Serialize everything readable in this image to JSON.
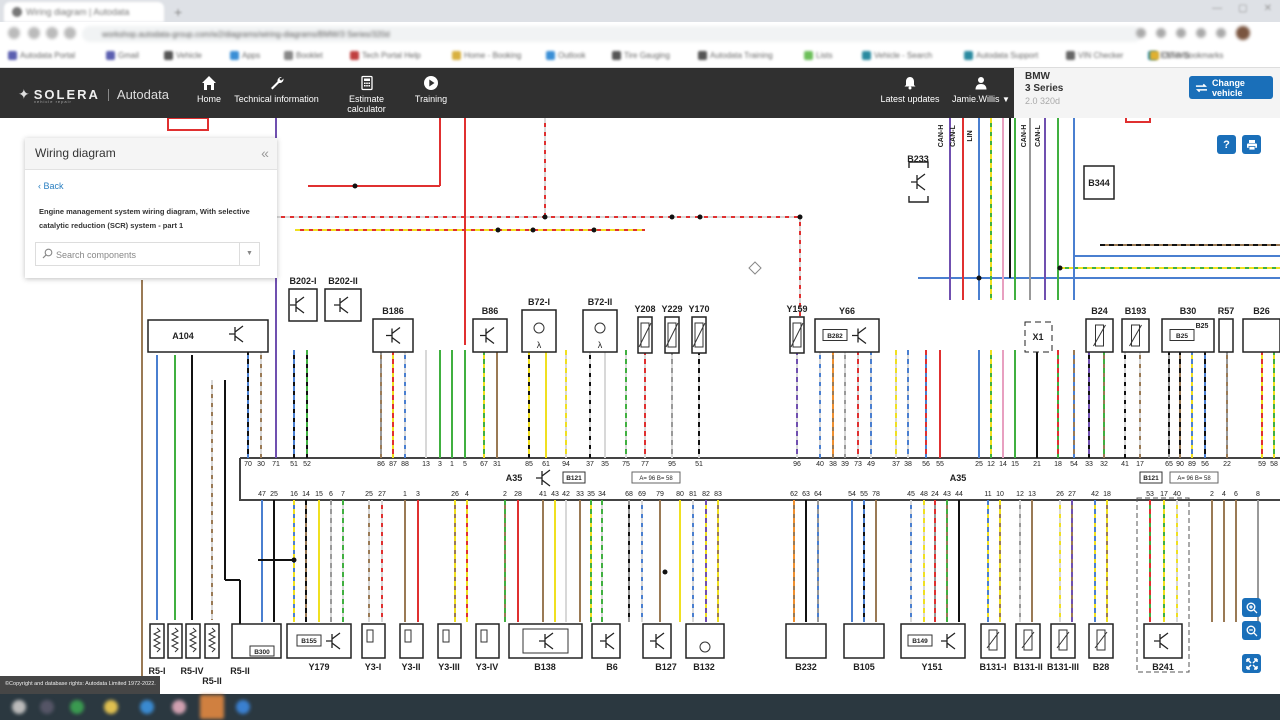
{
  "browser": {
    "tab_title": "Wiring diagram | Autodata",
    "url": "workshop.autodata-group.com/w2/diagrams/wiring-diagrams/BMW/3 Series/320d",
    "bookmarks": [
      {
        "label": "Autodata Portal",
        "color": "#5b5fb0"
      },
      {
        "label": "Gmail",
        "color": "#5b5fb0"
      },
      {
        "label": "Vehicle",
        "color": "#555"
      },
      {
        "label": "Apps",
        "color": "#3a8fd6"
      },
      {
        "label": "Booklet",
        "color": "#888"
      },
      {
        "label": "Tech Portal Help",
        "color": "#c04040"
      },
      {
        "label": "Home - Booking",
        "color": "#d8b040"
      },
      {
        "label": "Outlook",
        "color": "#3a8fd6"
      },
      {
        "label": "Tire Gauging",
        "color": "#555"
      },
      {
        "label": "Autodata Training",
        "color": "#555"
      },
      {
        "label": "Lists",
        "color": "#6cbf5a"
      },
      {
        "label": "Vehicle - Search",
        "color": "#2a8aa0"
      },
      {
        "label": "Autodata Support",
        "color": "#2a8aa0"
      },
      {
        "label": "VIN Checker",
        "color": "#666"
      },
      {
        "label": "ESTIMS",
        "color": "#2a8aa0"
      },
      {
        "label": "Other bookmarks",
        "color": "#e0b030"
      }
    ]
  },
  "app": {
    "brand": "SOLERA",
    "brand_sub": "vehicle repair",
    "product": "Autodata",
    "nav": [
      {
        "label": "Home",
        "icon": "home-icon"
      },
      {
        "label": "Technical information",
        "icon": "wrench-icon"
      },
      {
        "label": "Estimate calculator",
        "icon": "calculator-icon"
      },
      {
        "label": "Training",
        "icon": "play-icon"
      }
    ],
    "latest_updates": "Latest updates",
    "user": "Jamie.Willis"
  },
  "vehicle": {
    "make": "BMW",
    "model": "3 Series",
    "engine": "2.0 320d",
    "change_label": "Change vehicle"
  },
  "side_panel": {
    "title": "Wiring diagram",
    "back": "Back",
    "description": "Engine management system wiring diagram, With selective catalytic reduction (SCR) system - part 1",
    "search_placeholder": "Search components"
  },
  "tools": {
    "help": "?",
    "zoom_in": "zoom-in",
    "zoom_out": "zoom-out",
    "fit": "fit-to-screen"
  },
  "copyright": "©Copyright and database rights: Autodata Limited 1972-2022.",
  "diagram": {
    "ecu": {
      "label": "A35",
      "ref": "B121",
      "note": "A= 96 B= 58"
    },
    "upper_pins": [
      "70",
      "30",
      "71",
      "51",
      "52",
      "86",
      "87",
      "88",
      "13",
      "3",
      "1",
      "5",
      "67",
      "31",
      "85",
      "61",
      "94",
      "37",
      "35",
      "75",
      "77",
      "95",
      "51",
      "96",
      "40",
      "38",
      "39",
      "73",
      "49",
      "37",
      "38",
      "56",
      "55",
      "25",
      "12",
      "14",
      "15",
      "21",
      "18",
      "54",
      "33",
      "32",
      "41",
      "17",
      "65",
      "90",
      "89",
      "56",
      "22",
      "59",
      "58"
    ],
    "lower_pins": [
      "47",
      "25",
      "16",
      "14",
      "15",
      "6",
      "7",
      "25",
      "27",
      "1",
      "3",
      "26",
      "4",
      "2",
      "28",
      "41",
      "43",
      "42",
      "33",
      "35",
      "34",
      "68",
      "69",
      "79",
      "80",
      "81",
      "82",
      "83",
      "62",
      "63",
      "64",
      "54",
      "55",
      "78",
      "45",
      "48",
      "24",
      "43",
      "44",
      "11",
      "10",
      "12",
      "13",
      "26",
      "27",
      "42",
      "18",
      "53",
      "17",
      "40",
      "2",
      "4",
      "6",
      "8"
    ],
    "top_components": [
      {
        "id": "A104"
      },
      {
        "id": "B202-I"
      },
      {
        "id": "B202-II"
      },
      {
        "id": "B186"
      },
      {
        "id": "B86"
      },
      {
        "id": "B72-I"
      },
      {
        "id": "B72-II"
      },
      {
        "id": "Y208"
      },
      {
        "id": "Y229"
      },
      {
        "id": "Y170"
      },
      {
        "id": "Y159"
      },
      {
        "id": "Y66",
        "sub": "B282"
      },
      {
        "id": "B233"
      },
      {
        "id": "B344"
      },
      {
        "id": "X1"
      },
      {
        "id": "B24"
      },
      {
        "id": "B193"
      },
      {
        "id": "B30",
        "sub": "B25"
      },
      {
        "id": "R57"
      },
      {
        "id": "B26"
      }
    ],
    "bottom_components": [
      {
        "id": "R5-I"
      },
      {
        "id": "R5-IV"
      },
      {
        "id": "R5-II"
      },
      {
        "id": "R5-III"
      },
      {
        "id": "B300"
      },
      {
        "id": "Y179",
        "sub": "B155"
      },
      {
        "id": "Y3-I"
      },
      {
        "id": "Y3-II"
      },
      {
        "id": "Y3-III"
      },
      {
        "id": "Y3-IV"
      },
      {
        "id": "B138"
      },
      {
        "id": "B6"
      },
      {
        "id": "B127"
      },
      {
        "id": "B132"
      },
      {
        "id": "B232"
      },
      {
        "id": "B105"
      },
      {
        "id": "Y151",
        "sub": "B149"
      },
      {
        "id": "B131-I"
      },
      {
        "id": "B131-II"
      },
      {
        "id": "B131-III"
      },
      {
        "id": "B28"
      },
      {
        "id": "B241"
      }
    ],
    "bus_labels": [
      "CAN-H",
      "CAN-L",
      "LIN"
    ],
    "wire_colors": {
      "rt": "#e03030",
      "bl": "#4a7fd0",
      "gn": "#40b040",
      "sw": "#111111",
      "br": "#9a7a55",
      "ge": "#f0e020",
      "ws": "#d8d8d8",
      "vi": "#7050b0",
      "gr": "#999999",
      "rs": "#e8a0c0",
      "og": "#f09030"
    }
  }
}
